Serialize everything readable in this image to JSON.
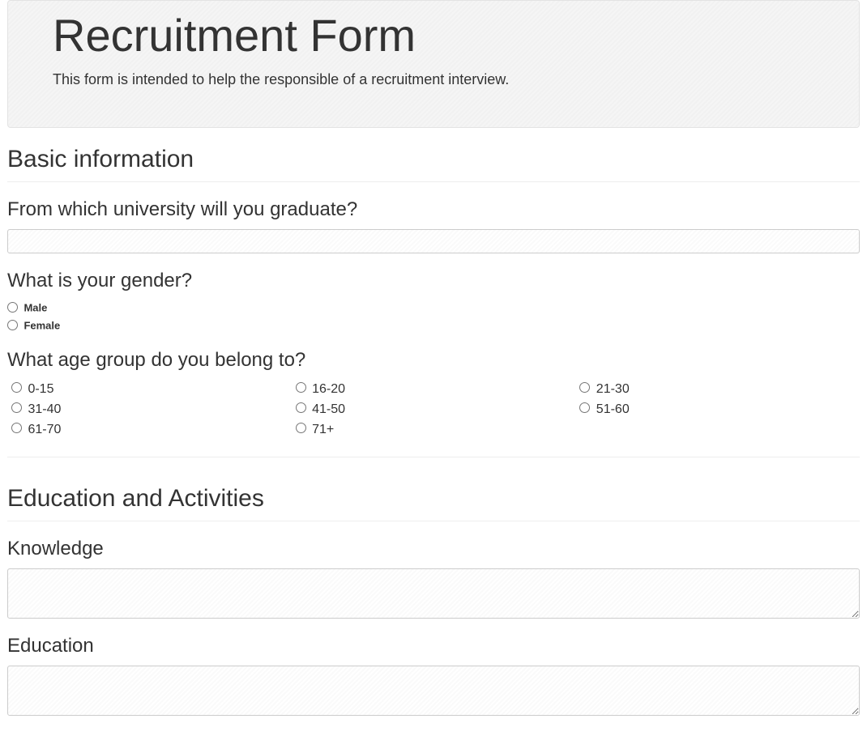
{
  "header": {
    "title": "Recruitment Form",
    "description": "This form is intended to help the responsible of a recruitment interview."
  },
  "sections": {
    "basic": {
      "title": "Basic information",
      "university": {
        "question": "From which university will you graduate?",
        "value": ""
      },
      "gender": {
        "question": "What is your gender?",
        "options": {
          "0": "Male",
          "1": "Female"
        }
      },
      "age": {
        "question": "What age group do you belong to?",
        "options": {
          "0": "0-15",
          "1": "16-20",
          "2": "21-30",
          "3": "31-40",
          "4": "41-50",
          "5": "51-60",
          "6": "61-70",
          "7": "71+"
        }
      }
    },
    "education": {
      "title": "Education and Activities",
      "knowledge": {
        "question": "Knowledge",
        "value": ""
      },
      "education_field": {
        "question": "Education",
        "value": ""
      }
    }
  }
}
